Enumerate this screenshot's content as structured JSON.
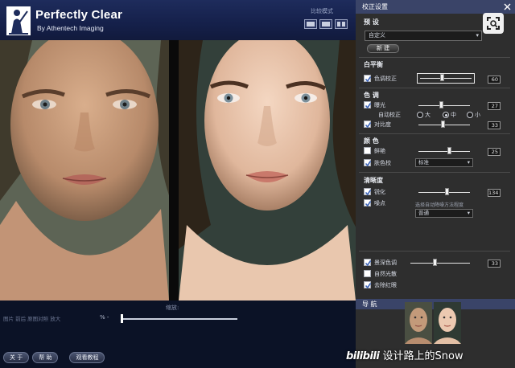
{
  "header": {
    "brand_title": "Perfectly Clear",
    "brand_subtitle": "By Athentech Imaging",
    "compare_mode_label": "比较模式"
  },
  "bottom": {
    "zoom_title": "缩放:",
    "hint_text": "图片 前后 原图对照 放大",
    "zoom_percent": "% -",
    "buttons": [
      "关 于",
      "帮 助",
      "观看教程"
    ]
  },
  "panel": {
    "title": "校正设置",
    "presets": {
      "title": "预 设",
      "selected": "自定义",
      "new_button": "新 建"
    },
    "white_balance": {
      "title": "白平衡",
      "color_correction": {
        "label": "色调校正",
        "value": "60",
        "checked": true
      }
    },
    "tone": {
      "title": "色 调",
      "exposure": {
        "label": "曝光",
        "value": "27",
        "checked": true
      },
      "auto_label": "自动校正",
      "radio_options": [
        "大",
        "中",
        "小"
      ],
      "radio_selected": "中",
      "contrast": {
        "label": "对比度",
        "value": "33",
        "checked": true
      }
    },
    "color": {
      "title": "颜 色",
      "vibrance": {
        "label": "鲜艳",
        "value": "25",
        "checked": false
      },
      "skin_tone": {
        "label": "肤色校",
        "checked": true,
        "select": "标准"
      }
    },
    "sharpness": {
      "title": "清晰度",
      "sharpen": {
        "label": "锐化",
        "value": "134",
        "checked": true
      },
      "noise": {
        "label": "噪点",
        "checked": true,
        "hint": "选择自动降噪方法程度",
        "select": "普通"
      }
    },
    "extra": {
      "depth": {
        "label": "景深色调",
        "value": "33",
        "checked": true
      },
      "light": {
        "label": "自然光散",
        "checked": false
      },
      "red_eye": {
        "label": "去除红眼",
        "checked": true
      }
    },
    "navigation": {
      "title": "导 航"
    }
  },
  "watermark": {
    "logo": "bilibili",
    "text": "设计路上的Snow"
  },
  "colors": {
    "header": "#1e2c5c",
    "panel": "#2e2e2e",
    "panel_title": "#3a4468",
    "accent": "#ffffff"
  }
}
